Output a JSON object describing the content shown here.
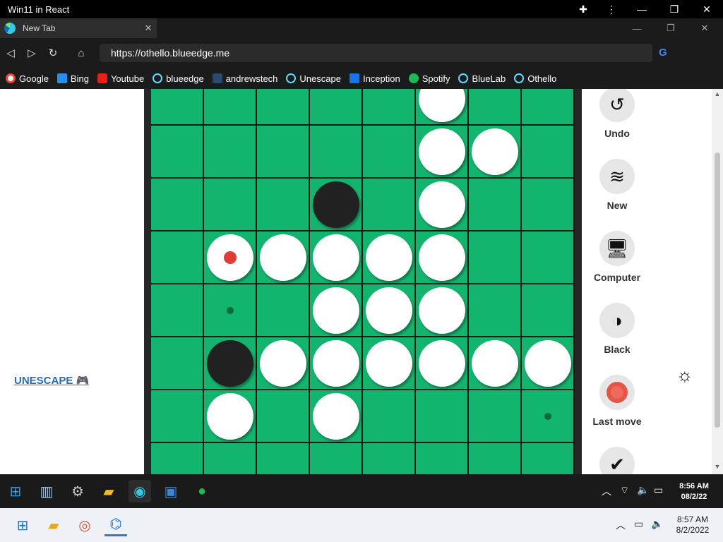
{
  "window": {
    "title": "Win11 in React"
  },
  "browser": {
    "tab_label": "New Tab",
    "url": "https://othello.blueedge.me",
    "bookmarks": [
      "Google",
      "Bing",
      "Youtube",
      "blueedge",
      "andrewstech",
      "Unescape",
      "Inception",
      "Spotify",
      "BlueLab",
      "Othello"
    ]
  },
  "page": {
    "left_link": "UNESCAPE",
    "controls": [
      "Undo",
      "New",
      "Computer",
      "Black",
      "Last move"
    ]
  },
  "board": {
    "size": 8,
    "visible_rows_note_free": true,
    "discs": [
      {
        "row": 0,
        "col": 5,
        "color": "white"
      },
      {
        "row": 1,
        "col": 5,
        "color": "white"
      },
      {
        "row": 1,
        "col": 6,
        "color": "white"
      },
      {
        "row": 2,
        "col": 3,
        "color": "black"
      },
      {
        "row": 2,
        "col": 5,
        "color": "white"
      },
      {
        "row": 3,
        "col": 1,
        "color": "white",
        "last_move": true
      },
      {
        "row": 3,
        "col": 2,
        "color": "white"
      },
      {
        "row": 3,
        "col": 3,
        "color": "white"
      },
      {
        "row": 3,
        "col": 4,
        "color": "white"
      },
      {
        "row": 3,
        "col": 5,
        "color": "white"
      },
      {
        "row": 4,
        "col": 3,
        "color": "white"
      },
      {
        "row": 4,
        "col": 4,
        "color": "white"
      },
      {
        "row": 4,
        "col": 5,
        "color": "white"
      },
      {
        "row": 5,
        "col": 1,
        "color": "black"
      },
      {
        "row": 5,
        "col": 2,
        "color": "white"
      },
      {
        "row": 5,
        "col": 3,
        "color": "white"
      },
      {
        "row": 5,
        "col": 4,
        "color": "white"
      },
      {
        "row": 5,
        "col": 5,
        "color": "white"
      },
      {
        "row": 5,
        "col": 6,
        "color": "white"
      },
      {
        "row": 5,
        "col": 7,
        "color": "white"
      },
      {
        "row": 6,
        "col": 1,
        "color": "white"
      },
      {
        "row": 6,
        "col": 3,
        "color": "white"
      }
    ],
    "hints": [
      {
        "row": 4,
        "col": 1
      },
      {
        "row": 6,
        "col": 7
      }
    ]
  },
  "inner_taskbar": {
    "time": "8:56 AM",
    "date": "08/2/22"
  },
  "outer_taskbar": {
    "time": "8:57 AM",
    "date": "8/2/2022"
  },
  "colors": {
    "board": "#13b56e",
    "last_move": "#e53935"
  }
}
